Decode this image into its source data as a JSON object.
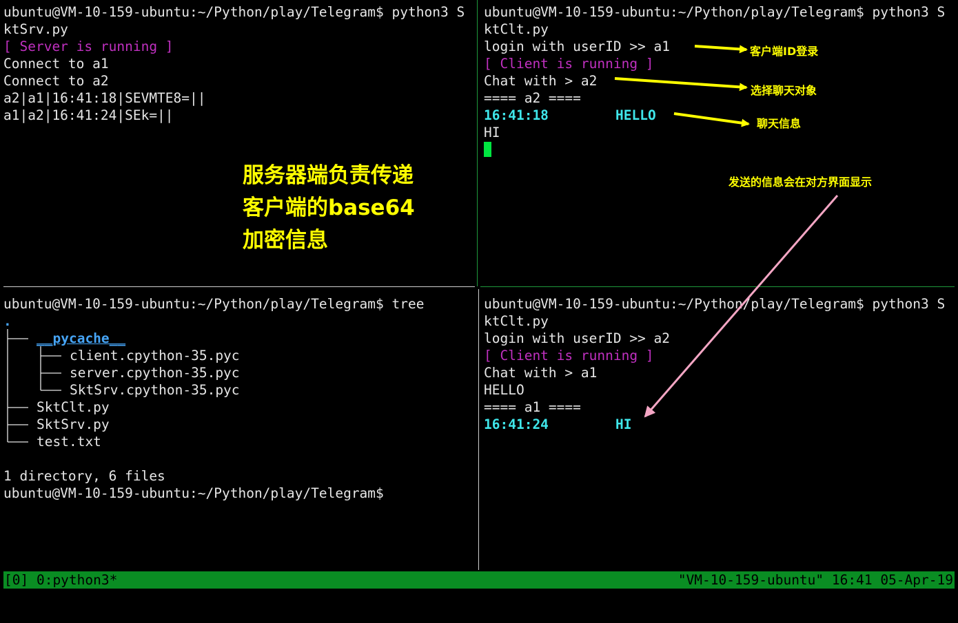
{
  "panes": {
    "top_left": {
      "lines": [
        "ubuntu@VM-10-159-ubuntu:~/Python/play/Telegram$ python3 S",
        "ktSrv.py",
        "[ Server is running ]",
        "Connect to a1",
        "Connect to a2",
        "a2|a1|16:41:18|SEVMTE8=||",
        "a1|a2|16:41:24|SEk=||"
      ]
    },
    "top_right": {
      "lines": [
        "ubuntu@VM-10-159-ubuntu:~/Python/play/Telegram$ python3 S",
        "ktClt.py",
        "login with userID >> a1",
        "[ Client is running ]",
        "Chat with > a2",
        "==== a2 ===="
      ],
      "message": {
        "time": "16:41:18",
        "text": "HELLO"
      },
      "input_line": "HI"
    },
    "bottom_left": {
      "lines": [
        "ubuntu@VM-10-159-ubuntu:~/Python/play/Telegram$ tree",
        "."
      ],
      "tree_dir": "__pycache__",
      "tree_files_nested": [
        "client.cpython-35.pyc",
        "server.cpython-35.pyc",
        "SktSrv.cpython-35.pyc"
      ],
      "tree_files_root": [
        "SktClt.py",
        "SktSrv.py",
        "test.txt"
      ],
      "summary": "1 directory, 6 files",
      "prompt": "ubuntu@VM-10-159-ubuntu:~/Python/play/Telegram$"
    },
    "bottom_right": {
      "lines": [
        "ubuntu@VM-10-159-ubuntu:~/Python/play/Telegram$ python3 S",
        "ktClt.py",
        "login with userID >> a2",
        "[ Client is running ]",
        "Chat with > a1",
        "HELLO",
        "==== a1 ===="
      ],
      "message": {
        "time": "16:41:24",
        "text": "HI"
      }
    }
  },
  "status_bar": {
    "left": "[0] 0:python3*",
    "right": "\"VM-10-159-ubuntu\" 16:41 05-Apr-19"
  },
  "annotations": {
    "login": "客户端ID登录",
    "chat_target": "选择聊天对象",
    "chat_message": "聊天信息",
    "sent_shown": "发送的信息会在对方界面显示",
    "server_note": [
      "服务器端负责传递",
      "客户端的base64",
      "加密信息"
    ]
  },
  "colors": {
    "background": "#000000",
    "text": "#e6e6e6",
    "magenta": "#c030c0",
    "cyan": "#3fe6ea",
    "directory_blue": "#46a4f5",
    "status_green": "#0a8d23",
    "annotation_yellow": "#ffff00",
    "arrow_pink": "#f4a6c4"
  }
}
